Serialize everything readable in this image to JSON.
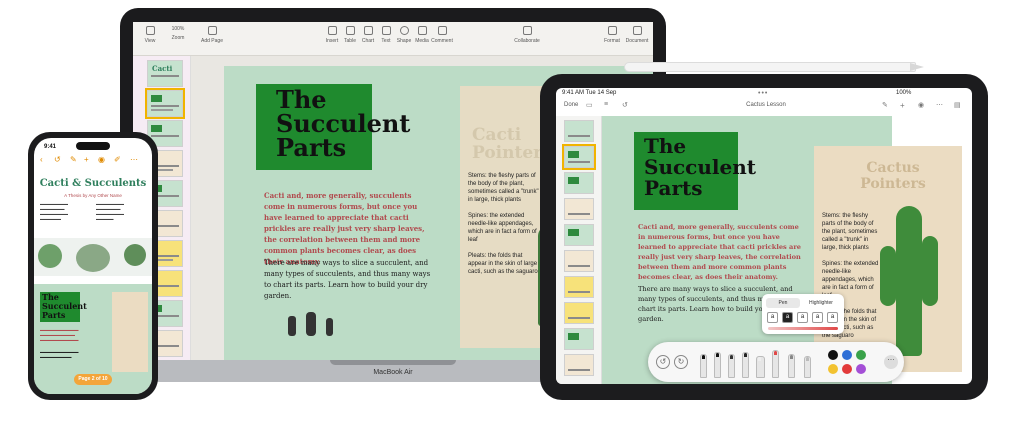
{
  "mac": {
    "label": "MacBook Air",
    "toolbar": {
      "items": [
        "View",
        "Zoom",
        "Add Page",
        "Insert",
        "Table",
        "Chart",
        "Text",
        "Shape",
        "Media",
        "Comment",
        "Collaborate",
        "Format",
        "Document"
      ],
      "zoom": "100%"
    },
    "thumbnails": [
      "Cacti",
      "",
      "",
      "",
      "",
      "",
      "",
      "",
      "",
      ""
    ],
    "page": {
      "title_lines": [
        "The",
        "Succulent",
        "Parts"
      ],
      "intro": "Cacti and, more generally, succulents come in numerous forms, but once you have learned to appreciate that cacti prickles are really just very sharp leaves, the correlation between them and more common plants becomes clear, as does their anatomy.",
      "body": "There are many ways to slice a succulent, and many types of succulents, and thus many ways to chart its parts. Learn how to build your dry garden.",
      "sidebar_ghost": [
        "Cacti",
        "Pointers"
      ],
      "sidebar_text": "Stems: the fleshy parts of the body of the plant, sometimes called a \"trunk\" in large, thick plants\n\nSpines: the extended needle-like appendages, which are in fact a form of leaf\n\nPleats: the folds that appear in the skin of large cacti, such as the saguaro"
    }
  },
  "ipad": {
    "status_time": "9:41 AM",
    "status_date": "Tue 14 Sep",
    "status_right": "100%",
    "done_label": "Done",
    "doc_title": "Cactus Lesson",
    "page": {
      "title_lines": [
        "The",
        "Succulent",
        "Parts"
      ],
      "intro": "Cacti and, more generally, succulents come in numerous forms, but once you have learned to appreciate that cacti prickles are really just very sharp leaves, the correlation between them and more common plants becomes clear, as does their anatomy.",
      "body": "There are many ways to slice a succulent, and many types of succulents, and thus many ways to chart its parts. Learn how to build your dry garden.",
      "sidebar_ghost": [
        "Cactus",
        "Pointers"
      ],
      "sidebar_text": "Stems: the fleshy parts of the body of the plant, sometimes called a \"trunk\" in large, thick plants\n\nSpines: the extended needle-like appendages, which are in fact a form of leaf\n\nPleats: the folds that appear in the skin of large cacti, such as the saguaro"
    },
    "pen_popup": {
      "tabs": [
        "Pen",
        "Highlighter"
      ],
      "selected_tab": "Pen"
    },
    "palette": {
      "swatches": [
        "#111111",
        "#2f6fd6",
        "#3aa24a",
        "#f2c230",
        "#e23a3a",
        "#a44fd6"
      ]
    }
  },
  "iphone": {
    "status_time": "9:41",
    "title": "Cacti & Succulents",
    "subtitle": "A Thesis by Any Other Name",
    "page": {
      "title_lines": [
        "The",
        "Succulent",
        "Parts"
      ]
    },
    "page_badge": "Page 2 of 10"
  },
  "colors": {
    "accent_green": "#1f8a2e",
    "page_green": "#bcdcc6",
    "intro_red": "#b14a4e",
    "highlight_orange": "#f3a53a"
  }
}
